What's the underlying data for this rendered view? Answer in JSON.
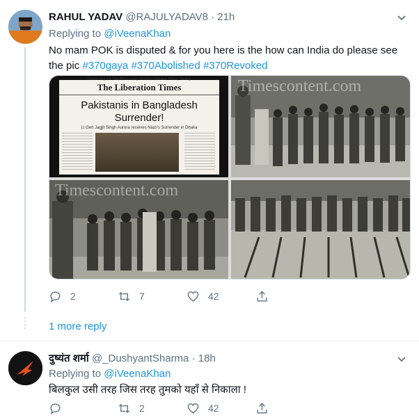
{
  "tweet1": {
    "name": "RAHUL YADAV",
    "handle": "@RAJULYADAV8",
    "separator": "·",
    "time": "21h",
    "replying_prefix": "Replying to",
    "replying_to": "@iVeenaKhan",
    "text": "No mam POK is disputed & for you here is the how can India do please see the pic",
    "hashtags": [
      "#370gaya",
      "#370Abolished",
      "#370Revoked"
    ],
    "media": {
      "newspaper_banner": "Connecting the 70th Anniversary of India's Greatest Military Victory",
      "newspaper_masthead": "The Liberation Times",
      "newspaper_headline": "Pakistanis in Bangladesh Surrender!",
      "newspaper_subhead": "Lt Gen Jagjit Singh Aurora receives Niazi's Surrender in Dhaka",
      "watermark": "Timescontent.com"
    },
    "actions": {
      "reply_count": "2",
      "retweet_count": "7",
      "like_count": "42"
    },
    "more_replies": "1 more reply"
  },
  "tweet2": {
    "name": "दुष्यंत शर्मा",
    "handle": "@_DushyantSharma",
    "separator": "·",
    "time": "18h",
    "replying_prefix": "Replying to",
    "replying_to": "@iVeenaKhan",
    "text": "बिलकुल उसी तरह जिस तरह तुमको यहाँ से निकाला !",
    "actions": {
      "reply_count": "",
      "retweet_count": "2",
      "like_count": "42"
    }
  },
  "colors": {
    "link": "#1b95e0",
    "secondary_text": "#5b7083",
    "divider": "#e6ecf0"
  },
  "icons": [
    "chevron-down-icon",
    "reply-icon",
    "retweet-icon",
    "like-icon",
    "share-icon"
  ]
}
